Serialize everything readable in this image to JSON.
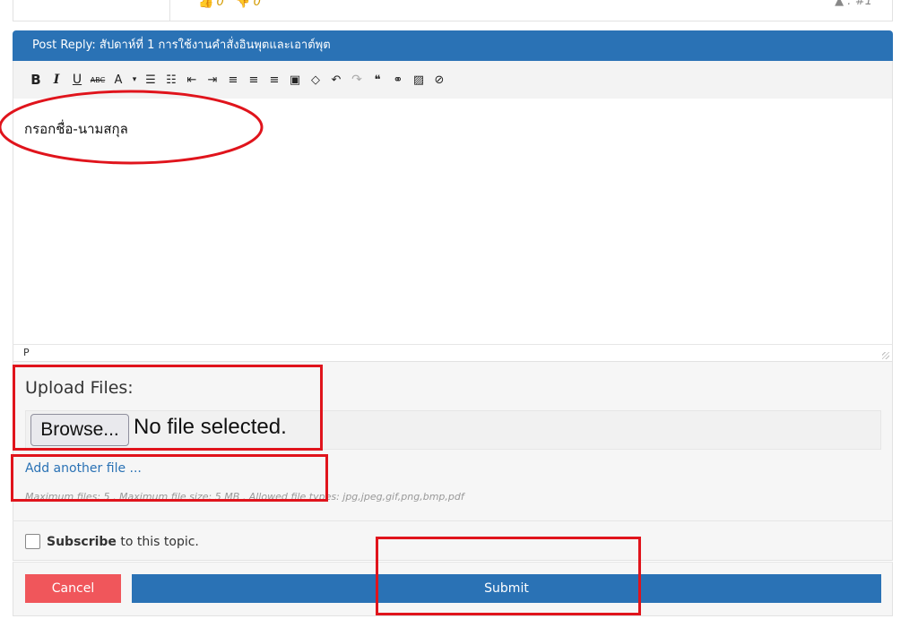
{
  "previous_post": {
    "likes": "0",
    "dislikes": "0",
    "post_number": "#1"
  },
  "reply": {
    "header": "Post Reply: สัปดาห์ที่ 1 การใช้งานคำสั่งอินพุตและเอาต์พุต",
    "toolbar": [
      {
        "name": "bold",
        "glyph": "B"
      },
      {
        "name": "italic",
        "glyph": "I"
      },
      {
        "name": "underline",
        "glyph": "U"
      },
      {
        "name": "strikethrough",
        "glyph": "ABC"
      },
      {
        "name": "text-color",
        "glyph": "A"
      },
      {
        "name": "text-color-dropdown",
        "glyph": "▾"
      },
      {
        "name": "bullet-list",
        "glyph": "☰"
      },
      {
        "name": "numbered-list",
        "glyph": "☷"
      },
      {
        "name": "outdent",
        "glyph": "⇤"
      },
      {
        "name": "indent",
        "glyph": "⇥"
      },
      {
        "name": "align-left",
        "glyph": "≡"
      },
      {
        "name": "align-center",
        "glyph": "≡"
      },
      {
        "name": "align-right",
        "glyph": "≡"
      },
      {
        "name": "paste",
        "glyph": "▣"
      },
      {
        "name": "eraser",
        "glyph": "◇"
      },
      {
        "name": "undo",
        "glyph": "↶"
      },
      {
        "name": "redo",
        "glyph": "↷"
      },
      {
        "name": "blockquote",
        "glyph": "❝"
      },
      {
        "name": "link",
        "glyph": "⚭"
      },
      {
        "name": "image",
        "glyph": "▨"
      },
      {
        "name": "hide",
        "glyph": "⊘"
      }
    ],
    "editor_text": "กรอกชื่อ-นามสกุล",
    "status_path": "P"
  },
  "upload": {
    "label": "Upload Files:",
    "browse_label": "Browse...",
    "file_status": "No file selected.",
    "add_another": "Add another file ...",
    "limits": "Maximum files: 5 , Maximum file size: 5 MB , Allowed file types: jpg,jpeg,gif,png,bmp,pdf"
  },
  "subscribe": {
    "bold": "Subscribe",
    "rest": " to this topic.",
    "checked": false
  },
  "actions": {
    "cancel": "Cancel",
    "submit": "Submit"
  },
  "colors": {
    "header_blue": "#2a72b5",
    "cancel_red": "#f0565b",
    "annotation_red": "#e0141c"
  }
}
